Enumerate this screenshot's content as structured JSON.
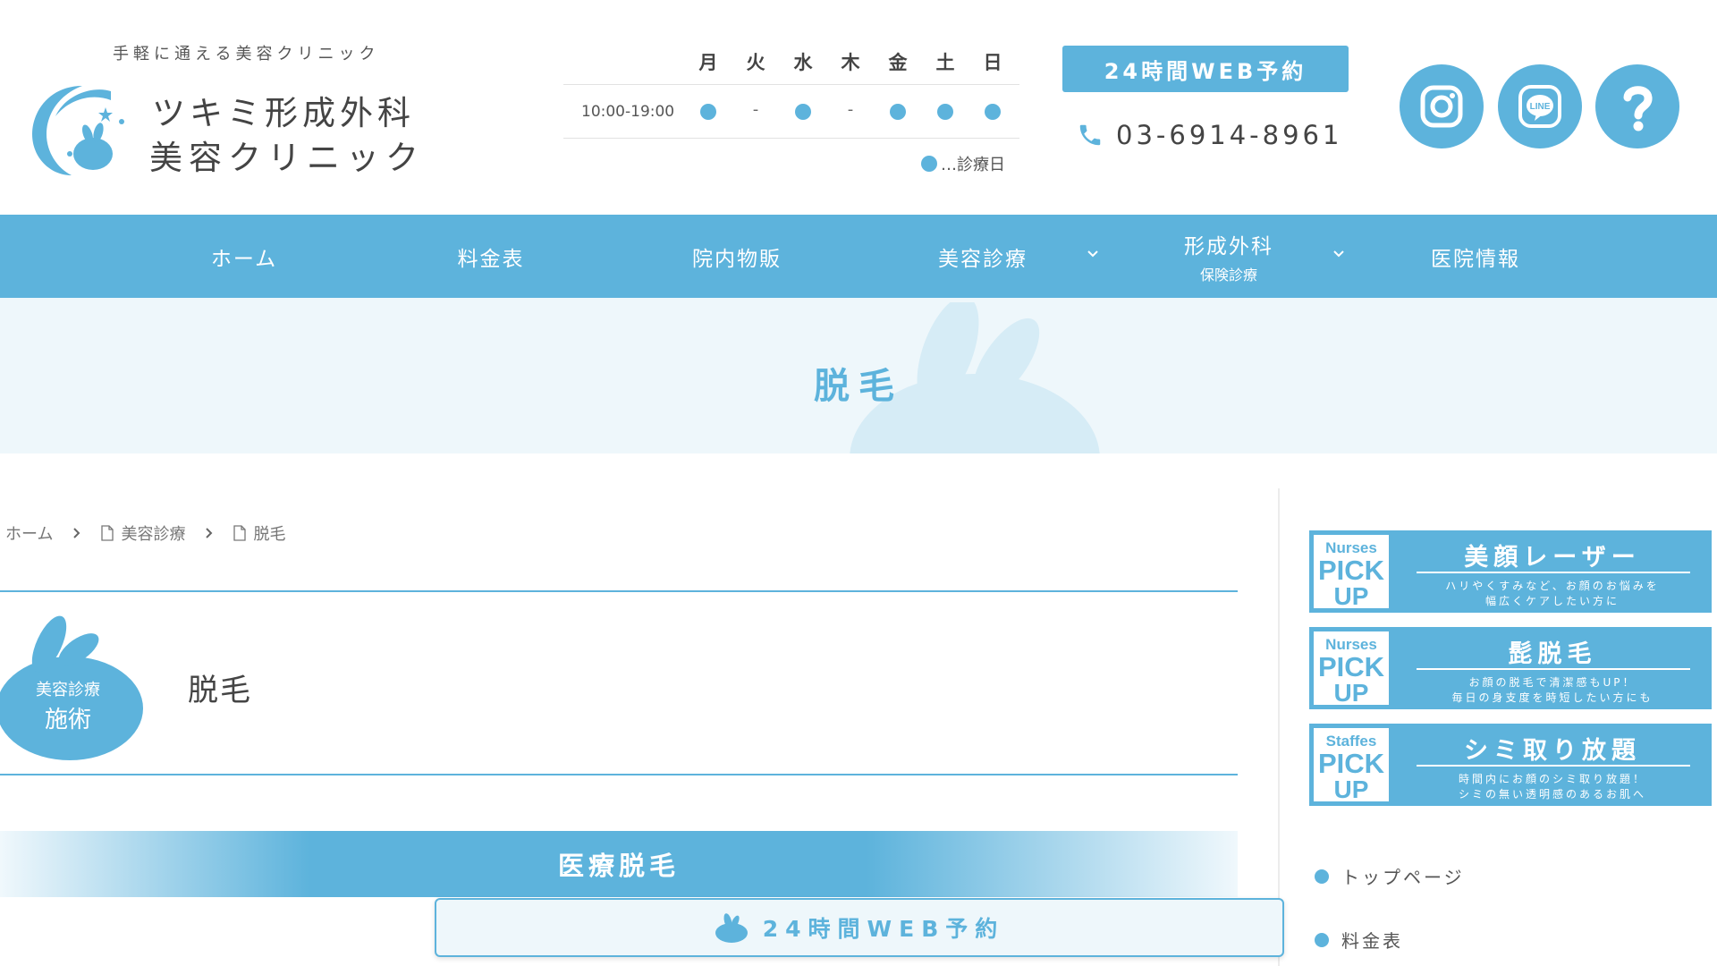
{
  "header": {
    "tagline": "手軽に通える美容クリニック",
    "logo_line1": "ツキミ形成外科",
    "logo_line2": "美容クリニック",
    "schedule": {
      "days": [
        "月",
        "火",
        "水",
        "木",
        "金",
        "土",
        "日"
      ],
      "hours": "10:00-19:00",
      "open": [
        true,
        false,
        true,
        false,
        true,
        true,
        true
      ],
      "closed_mark": "-",
      "legend": "…診療日"
    },
    "web_booking": "24時間WEB予約",
    "phone": "03-6914-8961",
    "icons": [
      "instagram-icon",
      "line-icon",
      "help-icon"
    ]
  },
  "nav": {
    "items": [
      {
        "label": "ホーム",
        "sub": "",
        "dropdown": false
      },
      {
        "label": "料金表",
        "sub": "",
        "dropdown": false
      },
      {
        "label": "院内物販",
        "sub": "",
        "dropdown": false
      },
      {
        "label": "美容診療",
        "sub": "",
        "dropdown": true
      },
      {
        "label": "形成外科",
        "sub": "保険診療",
        "dropdown": true
      },
      {
        "label": "医院情報",
        "sub": "",
        "dropdown": false
      }
    ]
  },
  "hero": {
    "title": "脱毛"
  },
  "breadcrumb": {
    "home": "ホーム",
    "category": "美容診療",
    "current": "脱毛"
  },
  "main": {
    "badge_line1": "美容診療",
    "badge_line2": "施術",
    "page_title": "脱毛",
    "section_title": "医療脱毛",
    "web_booking": "24時間WEB予約"
  },
  "sidebar": {
    "banners": [
      {
        "top": "Nurses",
        "mid": "PICK",
        "bot": "UP",
        "title": "美顔レーザー",
        "desc1": "ハリやくすみなど、お顔のお悩みを",
        "desc2": "幅広くケアしたい方に"
      },
      {
        "top": "Nurses",
        "mid": "PICK",
        "bot": "UP",
        "title": "髭脱毛",
        "desc1": "お顔の脱毛で清潔感もUP！",
        "desc2": "毎日の身支度を時短したい方にも"
      },
      {
        "top": "Staffes",
        "mid": "PICK",
        "bot": "UP",
        "title": "シミ取り放題",
        "desc1": "時間内にお顔のシミ取り放題！",
        "desc2": "シミの無い透明感のあるお肌へ"
      }
    ],
    "links": [
      "トップページ",
      "料金表"
    ]
  },
  "colors": {
    "accent": "#5db3dc",
    "hero_bg": "#eef7fb",
    "text": "#444444"
  }
}
